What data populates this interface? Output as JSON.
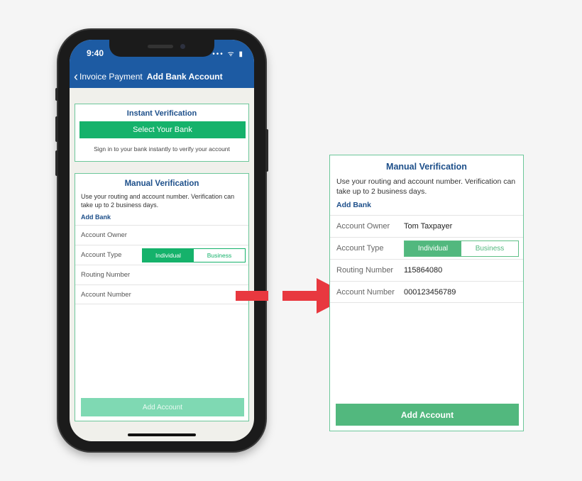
{
  "status_bar": {
    "time": "9:40",
    "icons": "••• ᯤ ▮"
  },
  "nav": {
    "back_label": "Invoice Payment",
    "title": "Add Bank Account"
  },
  "instant": {
    "title": "Instant Verification",
    "button_label": "Select Your Bank",
    "note": "Sign in to your bank instantly to verify your account"
  },
  "manual": {
    "title": "Manual Verification",
    "description": "Use your routing and account number. Verification can take up to 2 business days.",
    "add_bank_label": "Add Bank",
    "fields": {
      "owner_label": "Account Owner",
      "type_label": "Account Type",
      "routing_label": "Routing Number",
      "number_label": "Account Number"
    },
    "type_options": [
      "Individual",
      "Business"
    ],
    "selected_type": "Individual",
    "add_account_label": "Add Account"
  },
  "zoom_panel": {
    "title": "Manual Verification",
    "description": "Use your routing and account number. Verification can take up to 2 business days.",
    "add_bank_label": "Add Bank",
    "owner_label": "Account Owner",
    "owner_value": "Tom Taxpayer",
    "type_label": "Account Type",
    "type_options": [
      "Individual",
      "Business"
    ],
    "routing_label": "Routing Number",
    "routing_value": "115864080",
    "number_label": "Account Number",
    "number_value": "000123456789",
    "add_account_label": "Add Account"
  },
  "colors": {
    "brand_blue": "#1d5ba3",
    "accent_green": "#15b26b",
    "arrow_red": "#e8383f"
  }
}
